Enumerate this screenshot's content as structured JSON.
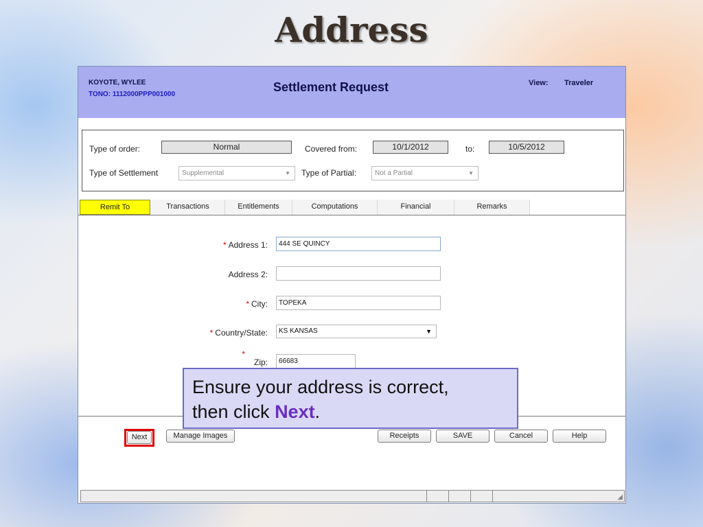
{
  "slide": {
    "title": "Address"
  },
  "app": {
    "header": {
      "traveler_name": "KOYOTE, WYLEE",
      "tono": "TONO: 1112000PPP001000",
      "title": "Settlement Request",
      "view_label": "View:",
      "view_value": "Traveler"
    },
    "order": {
      "type_of_order_label": "Type of order:",
      "type_of_order_value": "Normal",
      "covered_from_label": "Covered from:",
      "covered_from_value": "10/1/2012",
      "to_label": "to:",
      "to_value": "10/5/2012",
      "type_of_settlement_label": "Type of Settlement",
      "type_of_settlement_value": "Supplemental",
      "type_of_partial_label": "Type of Partial:",
      "type_of_partial_value": "Not a Partial"
    },
    "tabs": [
      {
        "label": "Remit To",
        "active": true
      },
      {
        "label": "Transactions"
      },
      {
        "label": "Entitlements"
      },
      {
        "label": "Computations"
      },
      {
        "label": "Financial"
      },
      {
        "label": "Remarks"
      }
    ],
    "form": {
      "required_mark": "*",
      "address1_label": "Address 1:",
      "address1_value": "444 SE QUINCY",
      "address2_label": "Address 2:",
      "address2_value": "",
      "city_label": "City:",
      "city_value": "TOPEKA",
      "country_state_label": "Country/State:",
      "country_state_value": "KS KANSAS",
      "zip_label": "Zip:",
      "zip_value": "66683"
    },
    "buttons": {
      "next": "Next",
      "manage_images": "Manage Images",
      "receipts": "Receipts",
      "save": "SAVE",
      "cancel": "Cancel",
      "help": "Help"
    }
  },
  "callout": {
    "line1": "Ensure your address is correct,",
    "line2_prefix": "then click ",
    "line2_emph": "Next",
    "line2_suffix": "."
  },
  "icons": {
    "dropdown": "chevron-down-icon",
    "resize": "resize-grip-icon"
  },
  "colors": {
    "header_bg": "#a9acef",
    "active_tab": "#ffff00",
    "required": "#e00000",
    "callout_bg": "#d9d9f6",
    "callout_emph": "#6a2ec0"
  }
}
